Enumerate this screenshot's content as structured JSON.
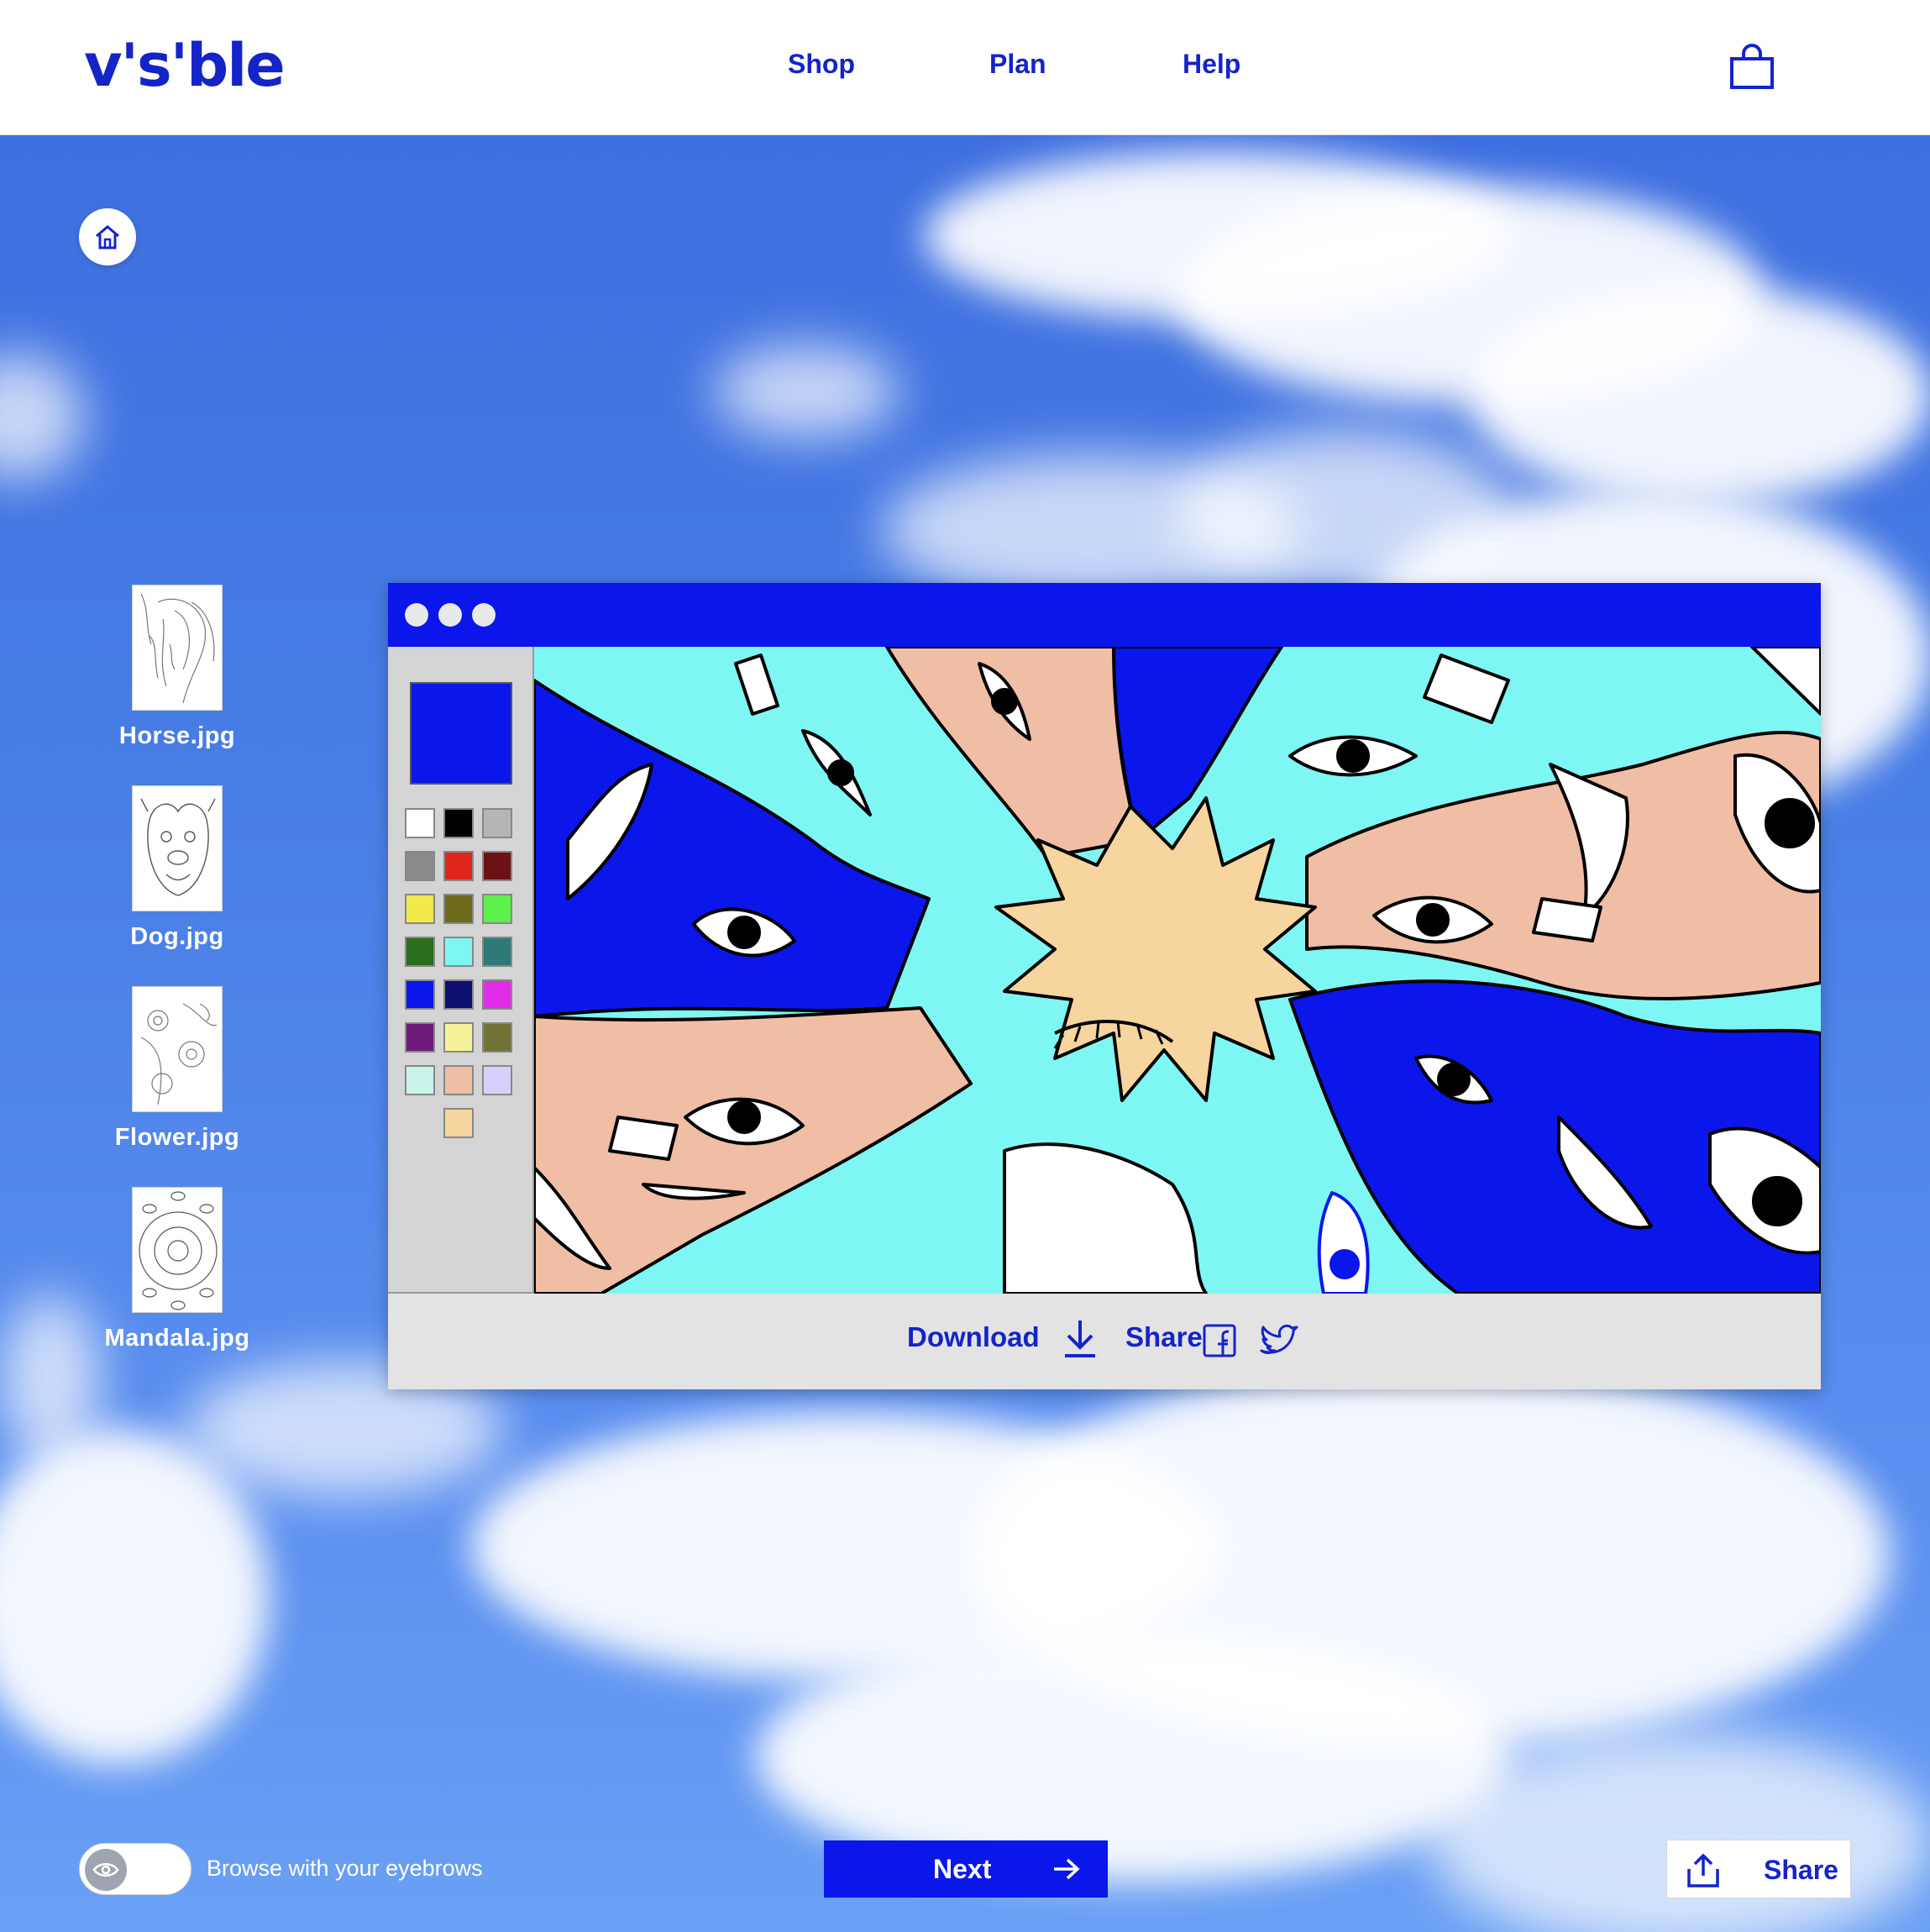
{
  "header": {
    "logo": "v's'ble",
    "nav": [
      "Shop",
      "Plan",
      "Help"
    ]
  },
  "files": [
    {
      "label": "Horse.jpg"
    },
    {
      "label": "Dog.jpg"
    },
    {
      "label": "Flower.jpg"
    },
    {
      "label": "Mandala.jpg"
    }
  ],
  "paint": {
    "current_color": "#0a16ea",
    "palette": [
      "#ffffff",
      "#000000",
      "#b5b5b5",
      "#8a8a8a",
      "#e0261c",
      "#6b1212",
      "#f2e94a",
      "#6e6a1c",
      "#5cf04a",
      "#2c6e1e",
      "#7ef6f3",
      "#2f7a78",
      "#0a16ea",
      "#0e0f6e",
      "#e02ee8",
      "#6e1a7a",
      "#f5f29a",
      "#717236",
      "#c9f4ea",
      "#f0bea4",
      "#d8d0fa",
      "#f6d59e"
    ],
    "download_label": "Download",
    "share_label": "Share"
  },
  "footer": {
    "toggle_label": "Browse with your eyebrows",
    "next_label": "Next",
    "share_label": "Share"
  },
  "colors": {
    "brand": "#1424c8",
    "accent": "#0a16ea",
    "cyan": "#7ef6f3",
    "peach": "#f0bea4",
    "sun": "#f6d59e"
  }
}
